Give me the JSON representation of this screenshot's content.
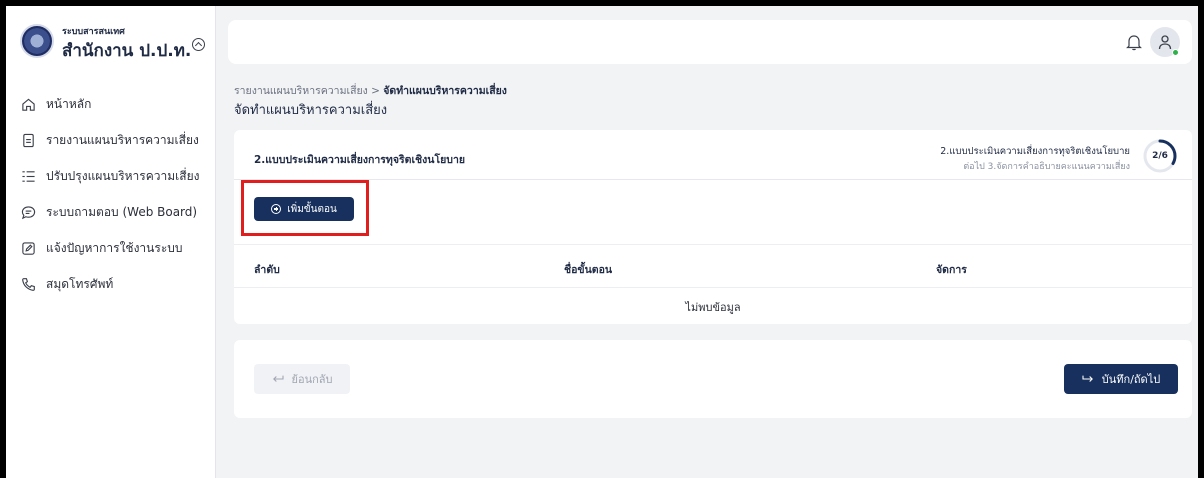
{
  "sidebar": {
    "brand_subtitle": "ระบบสารสนเทศ",
    "brand_title": "สำนักงาน ป.ป.ท.",
    "items": [
      {
        "label": "หน้าหลัก",
        "icon": "home-icon"
      },
      {
        "label": "รายงานแผนบริหารความเสี่ยง",
        "icon": "document-icon"
      },
      {
        "label": "ปรับปรุงแผนบริหารความเสี่ยง",
        "icon": "list-icon"
      },
      {
        "label": "ระบบถามตอบ (Web Board)",
        "icon": "chat-icon"
      },
      {
        "label": "แจ้งปัญหาการใช้งานระบบ",
        "icon": "edit-icon"
      },
      {
        "label": "สมุดโทรศัพท์",
        "icon": "phone-icon"
      }
    ]
  },
  "breadcrumb": {
    "parent": "รายงานแผนบริหารความเสี่ยง",
    "separator": " > ",
    "current": "จัดทำแผนบริหารความเสี่ยง"
  },
  "page_title": "จัดทำแผนบริหารความเสี่ยง",
  "card": {
    "title": "2.แบบประเมินความเสี่ยงการทุจริตเชิงนโยบาย",
    "step_current": "2.แบบประเมินความเสี่ยงการทุจริตเชิงนโยบาย",
    "step_next": "ต่อไป 3.จัดการคำอธิบายคะแนนความเสี่ยง",
    "progress_label": "2/6",
    "progress_fraction": 0.333,
    "add_button": "เพิ่มขั้นตอน",
    "columns": [
      "ลำดับ",
      "ชื่อขั้นตอน",
      "จัดการ"
    ],
    "empty_text": "ไม่พบข้อมูล"
  },
  "footer": {
    "back_label": "ย้อนกลับ",
    "next_label": "บันทึก/ถัดไป"
  },
  "colors": {
    "primary": "#17305e",
    "highlight": "#e01e1e",
    "online": "#2fb24c"
  }
}
